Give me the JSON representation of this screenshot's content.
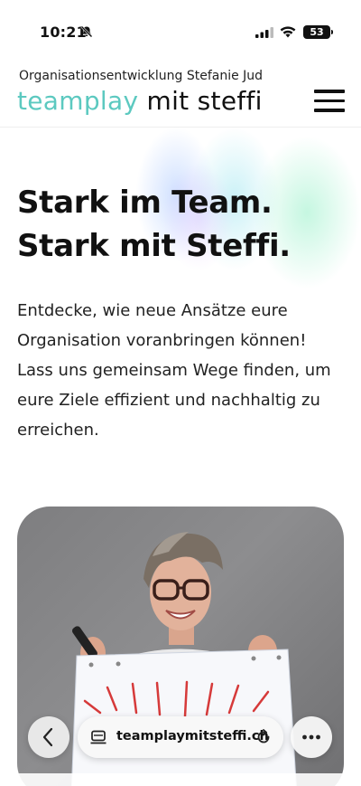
{
  "status_bar": {
    "time": "10:21",
    "battery": "53",
    "icons": [
      "bell-slash-icon",
      "cellular-signal-icon",
      "wifi-icon",
      "battery-icon"
    ]
  },
  "header": {
    "tagline": "Organisationsentwicklung Stefanie Jud",
    "brand_accent": "teamplay",
    "brand_rest": " mit steffi",
    "menu_icon": "hamburger-menu-icon"
  },
  "hero": {
    "headline_line1": "Stark im Team.",
    "headline_line2": "Stark mit Steffi.",
    "intro": "Entdecke, wie neue Ansätze eure Organisation voranbringen können! Lass uns gemeinsam Wege finden, um eure Ziele effizient und nachhaltig zu erreichen.",
    "image": "portrait-photo"
  },
  "browser": {
    "url": "teamplaymitsteffi.ch",
    "back_icon": "chevron-left-icon",
    "tabs_icon": "tabs-icon",
    "reload_icon": "reload-icon",
    "more_icon": "more-dots-icon"
  },
  "colors": {
    "brand_accent": "#5cc9c0",
    "text": "#111111",
    "image_bg": "#7e7e80"
  }
}
